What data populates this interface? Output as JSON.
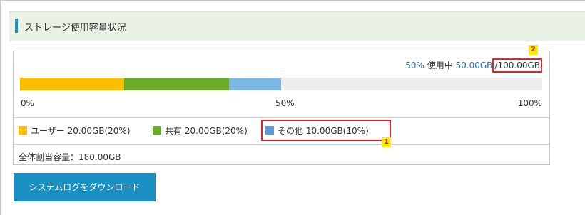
{
  "section": {
    "title": "ストレージ使用容量状況"
  },
  "usage": {
    "percent_label": "50%",
    "in_use_label": "使用中",
    "used": "50.00GB",
    "separator": "/",
    "total": "100.00GB",
    "used_fraction": 0.5
  },
  "bar": {
    "segments": [
      {
        "name": "ユーザー",
        "fraction": 0.2,
        "color": "#fbbf00"
      },
      {
        "name": "共有",
        "fraction": 0.2,
        "color": "#6aac2a"
      },
      {
        "name": "その他",
        "fraction": 0.1,
        "color": "#7ab7e3"
      }
    ],
    "track_color": "#eeeeee",
    "ticks": [
      "0%",
      "50%",
      "100%"
    ]
  },
  "legend": [
    {
      "label": "ユーザー",
      "value": "20.00GB(20%)",
      "color": "#fbbf00"
    },
    {
      "label": "共有",
      "value": "20.00GB(20%)",
      "color": "#6aac2a"
    },
    {
      "label": "その他",
      "value": "10.00GB(10%)",
      "color": "#5b9bd5"
    }
  ],
  "allocation": {
    "label": "全体割当容量：180.00GB"
  },
  "annotations": {
    "badge_1": "1",
    "badge_2": "2"
  },
  "actions": {
    "download_label": "システムログをダウンロード"
  },
  "colors": {
    "accent": "#1a8fc2",
    "highlight": "#e1252e",
    "badge_bg": "#ffeb00"
  }
}
